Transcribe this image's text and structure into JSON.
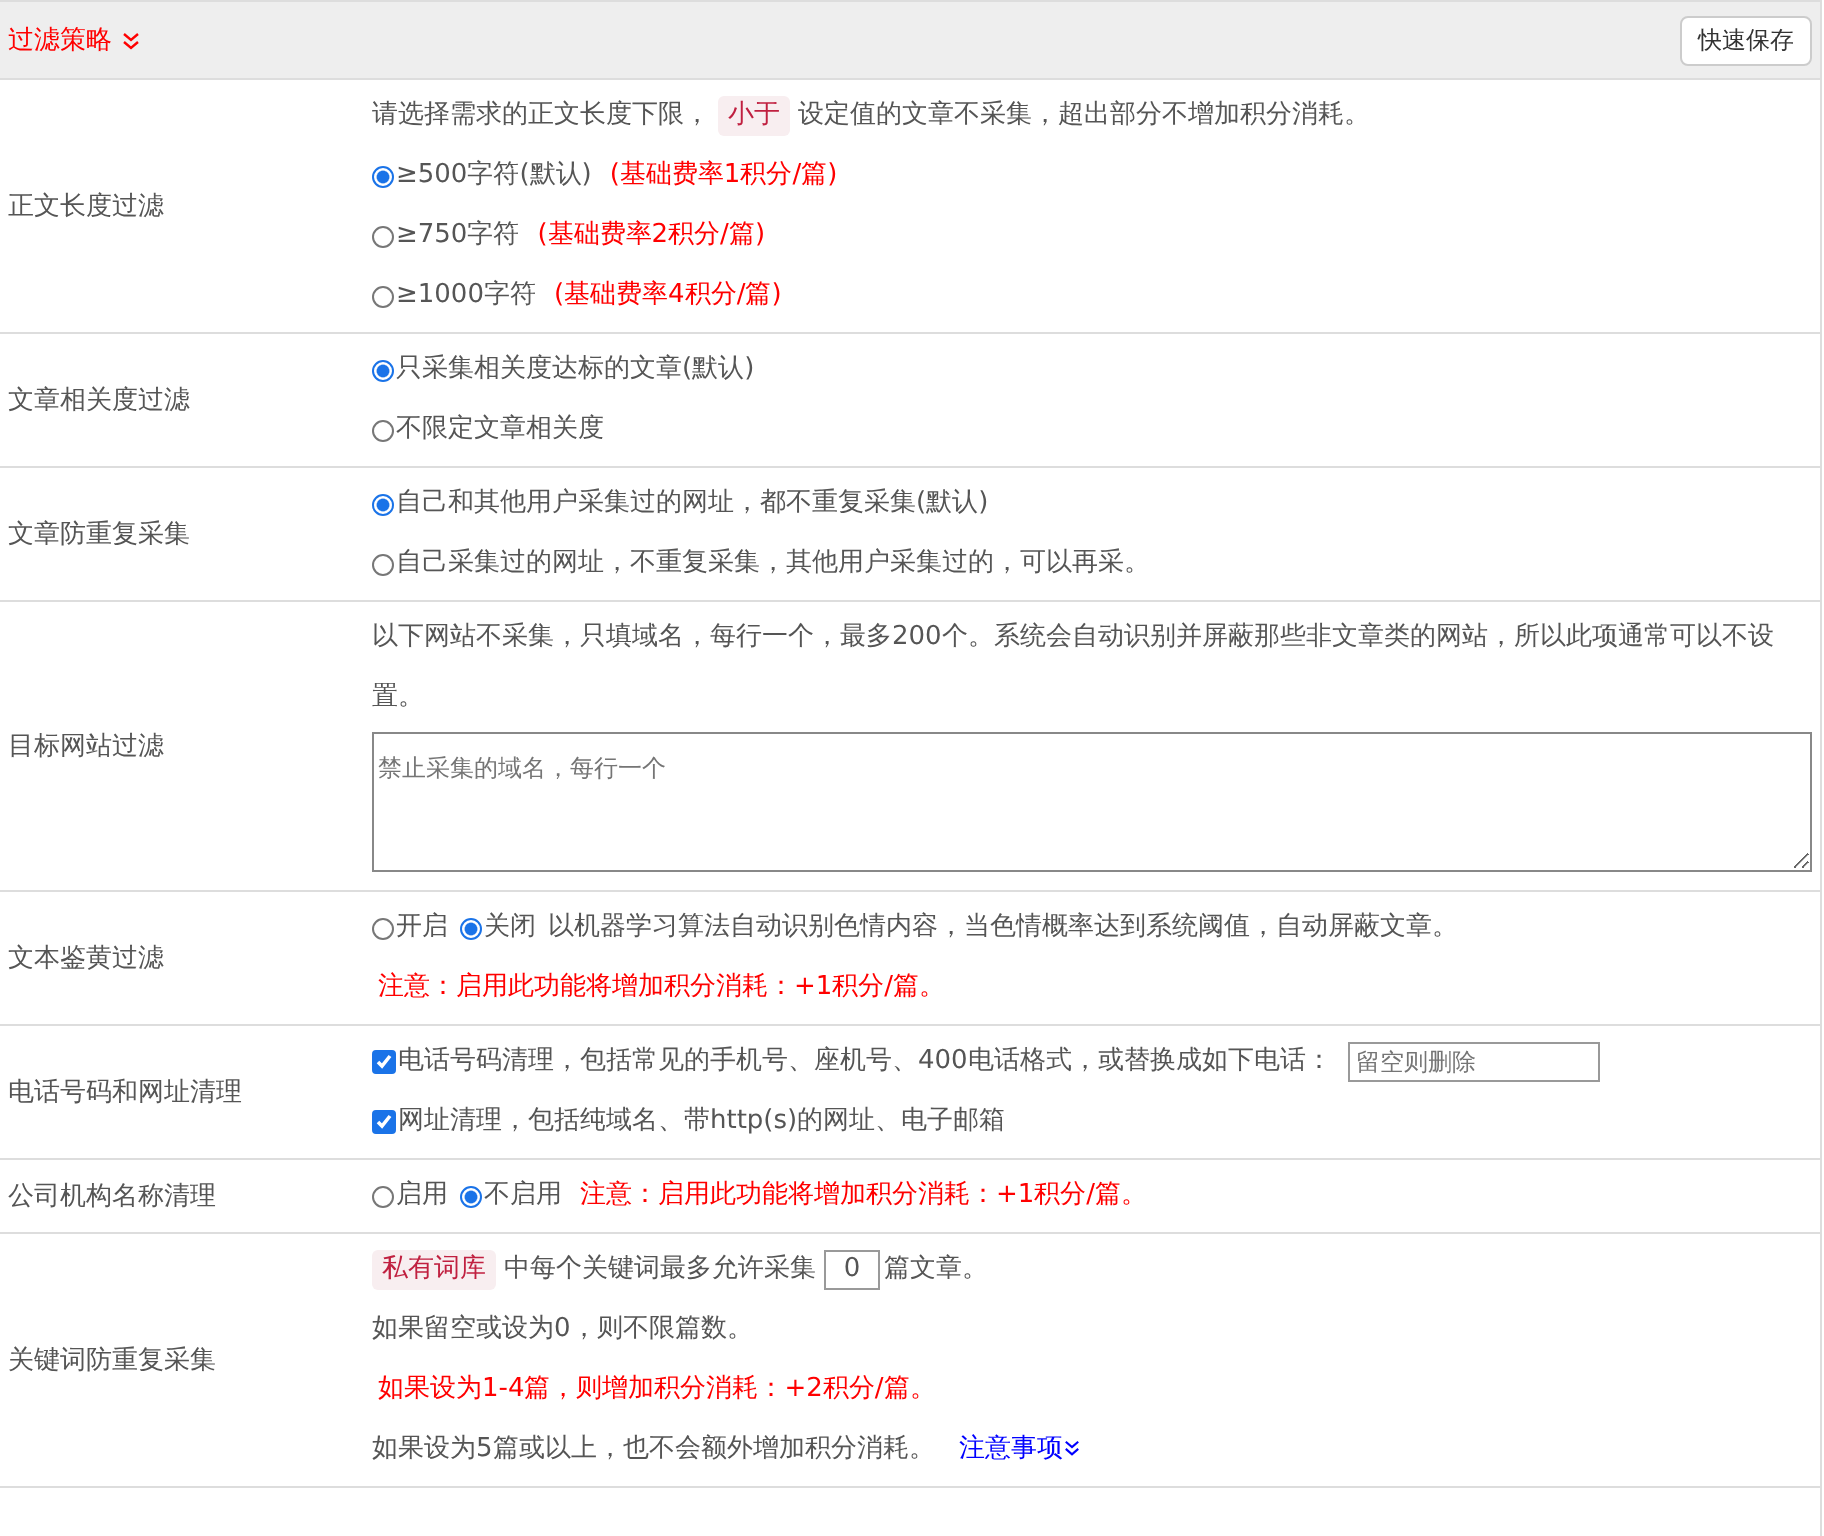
{
  "header": {
    "title": "过滤策略",
    "save_button": "快速保存"
  },
  "rows": [
    {
      "label": "正文长度过滤",
      "lines": [
        [
          {
            "kind": "text",
            "text": "请选择需求的正文长度下限，"
          },
          {
            "kind": "tag",
            "text": "小于"
          },
          {
            "kind": "text",
            "text": "设定值的文章不采集，超出部分不增加积分消耗。"
          }
        ],
        [
          {
            "kind": "radio",
            "label": "≥500字符(默认)",
            "selected": true
          },
          {
            "kind": "note",
            "text": "(基础费率1积分/篇)"
          }
        ],
        [
          {
            "kind": "radio",
            "label": "≥750字符",
            "selected": false
          },
          {
            "kind": "note",
            "text": "(基础费率2积分/篇)"
          }
        ],
        [
          {
            "kind": "radio",
            "label": "≥1000字符",
            "selected": false
          },
          {
            "kind": "note",
            "text": "(基础费率4积分/篇)"
          }
        ]
      ]
    },
    {
      "label": "文章相关度过滤",
      "lines": [
        [
          {
            "kind": "radio",
            "label": "只采集相关度达标的文章(默认)",
            "selected": true
          }
        ],
        [
          {
            "kind": "radio",
            "label": "不限定文章相关度",
            "selected": false
          }
        ]
      ]
    },
    {
      "label": "文章防重复采集",
      "lines": [
        [
          {
            "kind": "radio",
            "label": "自己和其他用户采集过的网址，都不重复采集(默认)",
            "selected": true
          }
        ],
        [
          {
            "kind": "radio",
            "label": "自己采集过的网址，不重复采集，其他用户采集过的，可以再采。",
            "selected": false
          }
        ]
      ]
    },
    {
      "label": "目标网站过滤",
      "lines": [
        [
          {
            "kind": "text",
            "text": "以下网站不采集，只填域名，每行一个，最多200个。系统会自动识别并屏蔽那些非文章类的网站，所以此项通常可以不设置。"
          }
        ],
        [
          {
            "kind": "textarea",
            "placeholder": "禁止采集的域名，每行一个"
          }
        ]
      ]
    },
    {
      "label": "文本鉴黄过滤",
      "lines": [
        [
          {
            "kind": "radio",
            "label": "开启",
            "selected": false
          },
          {
            "kind": "radio",
            "label": "关闭",
            "selected": true
          },
          {
            "kind": "text",
            "text": "以机器学习算法自动识别色情内容，当色情概率达到系统阈值，自动屏蔽文章。"
          }
        ],
        [
          {
            "kind": "note",
            "text": "注意：启用此功能将增加积分消耗：+1积分/篇。"
          }
        ]
      ]
    },
    {
      "label": "电话号码和网址清理",
      "lines": [
        [
          {
            "kind": "checkbox",
            "label": "电话号码清理，包括常见的手机号、座机号、400电话格式，或替换成如下电话：",
            "checked": true
          },
          {
            "kind": "input",
            "placeholder": "留空则删除"
          }
        ],
        [
          {
            "kind": "checkbox",
            "label": "网址清理，包括纯域名、带http(s)的网址、电子邮箱",
            "checked": true
          }
        ]
      ]
    },
    {
      "label": "公司机构名称清理",
      "lines": [
        [
          {
            "kind": "radio",
            "label": "启用",
            "selected": false
          },
          {
            "kind": "radio",
            "label": "不启用",
            "selected": true
          },
          {
            "kind": "note",
            "text": "注意：启用此功能将增加积分消耗：+1积分/篇。"
          }
        ]
      ]
    },
    {
      "label": "关键词防重复采集",
      "lines": [
        [
          {
            "kind": "tag",
            "text": "私有词库"
          },
          {
            "kind": "text",
            "text": "中每个关键词最多允许采集"
          },
          {
            "kind": "count",
            "value": "0"
          },
          {
            "kind": "text",
            "text": "篇文章。"
          }
        ],
        [
          {
            "kind": "text",
            "text": "如果留空或设为0，则不限篇数。"
          }
        ],
        [
          {
            "kind": "note",
            "text": "如果设为1-4篇，则增加积分消耗：+2积分/篇。"
          }
        ],
        [
          {
            "kind": "text",
            "text": "如果设为5篇或以上，也不会额外增加积分消耗。"
          },
          {
            "kind": "link",
            "text": "注意事项"
          }
        ]
      ]
    }
  ]
}
